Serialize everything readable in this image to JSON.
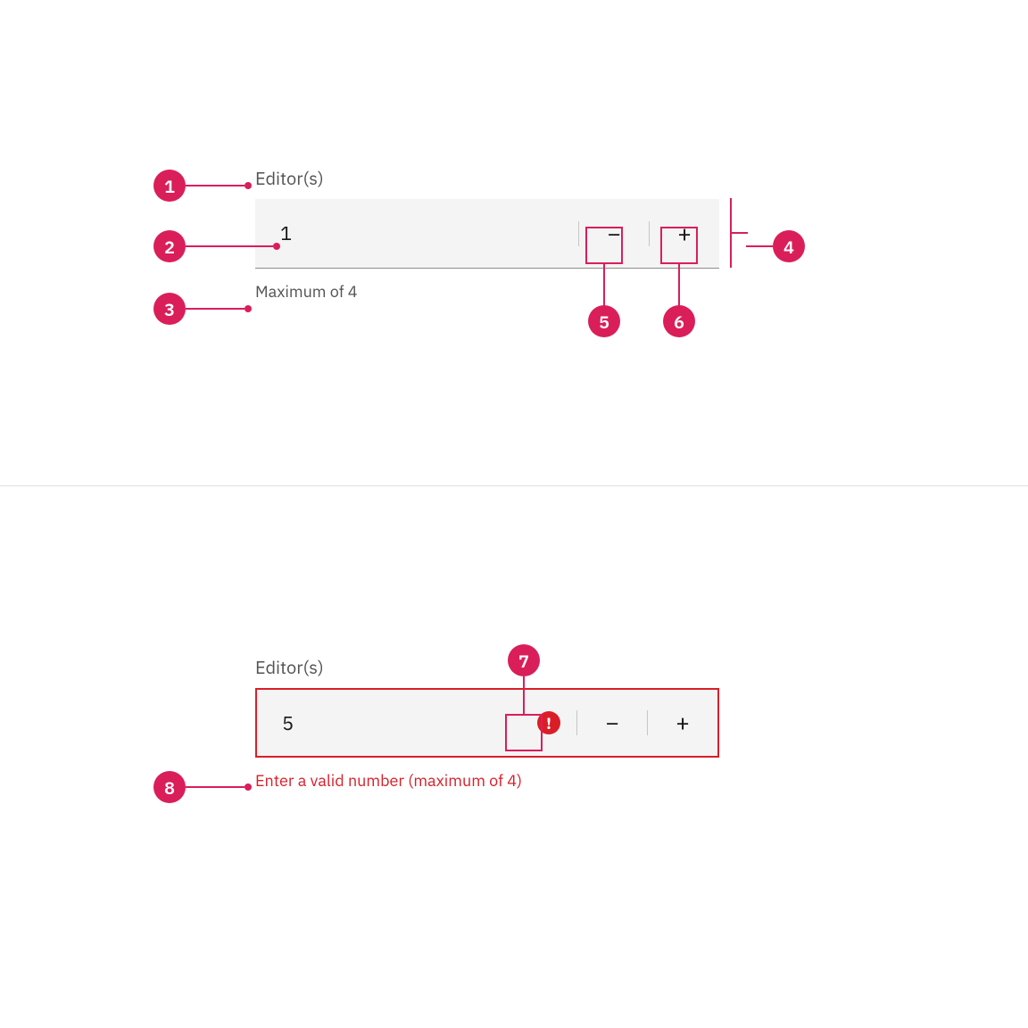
{
  "annotations": {
    "n1": "1",
    "n2": "2",
    "n3": "3",
    "n4": "4",
    "n5": "5",
    "n6": "6",
    "n7": "7",
    "n8": "8"
  },
  "normal": {
    "label": "Editor(s)",
    "value": "1",
    "helper": "Maximum of 4"
  },
  "invalid": {
    "label": "Editor(s)",
    "value": "5",
    "error": "Enter a valid number (maximum of 4)"
  },
  "icons": {
    "minus": "−",
    "plus": "+",
    "warn": "!"
  }
}
